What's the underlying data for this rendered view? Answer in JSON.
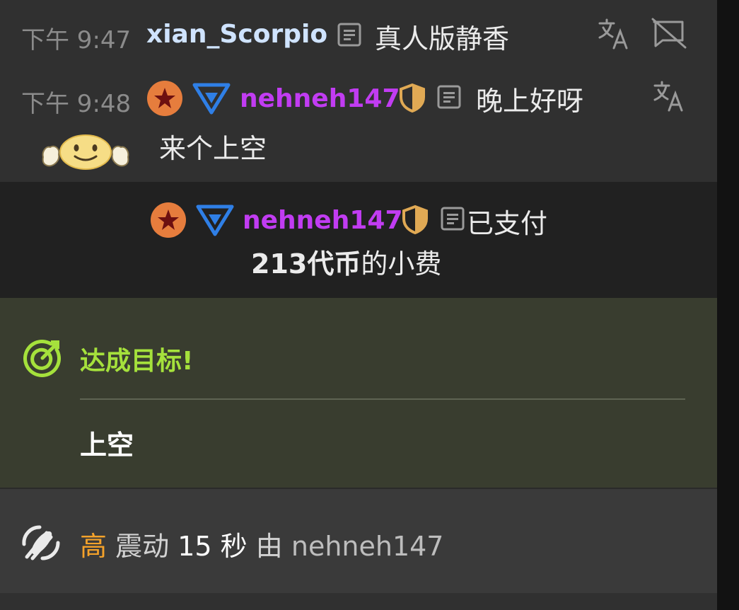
{
  "messages": [
    {
      "time": "下午 9:47",
      "username": "xian_Scorpio",
      "text": "真人版静香",
      "username_color": "#cfe3ff",
      "actions": [
        "translate-icon",
        "hide-icon"
      ]
    },
    {
      "time": "下午 9:48",
      "username": "nehneh147",
      "text": "晚上好呀",
      "text_line2": "来个上空",
      "username_color": "#c13cf2",
      "actions": [
        "translate-icon"
      ]
    }
  ],
  "tip": {
    "username": "nehneh147",
    "text": "已支付",
    "amount": "213代币",
    "suffix": "的小费",
    "username_color": "#c13cf2"
  },
  "goal": {
    "title": "达成目标!",
    "description": "上空",
    "accent_color": "#a5e13c"
  },
  "vibration": {
    "level": "高",
    "action": "震动",
    "duration": "15 秒",
    "by": "由",
    "username": "nehneh147",
    "level_color": "#f5a22a"
  },
  "colors": {
    "panel_bg": "#303030",
    "tip_bg": "#212121",
    "goal_bg": "#393d2f"
  }
}
